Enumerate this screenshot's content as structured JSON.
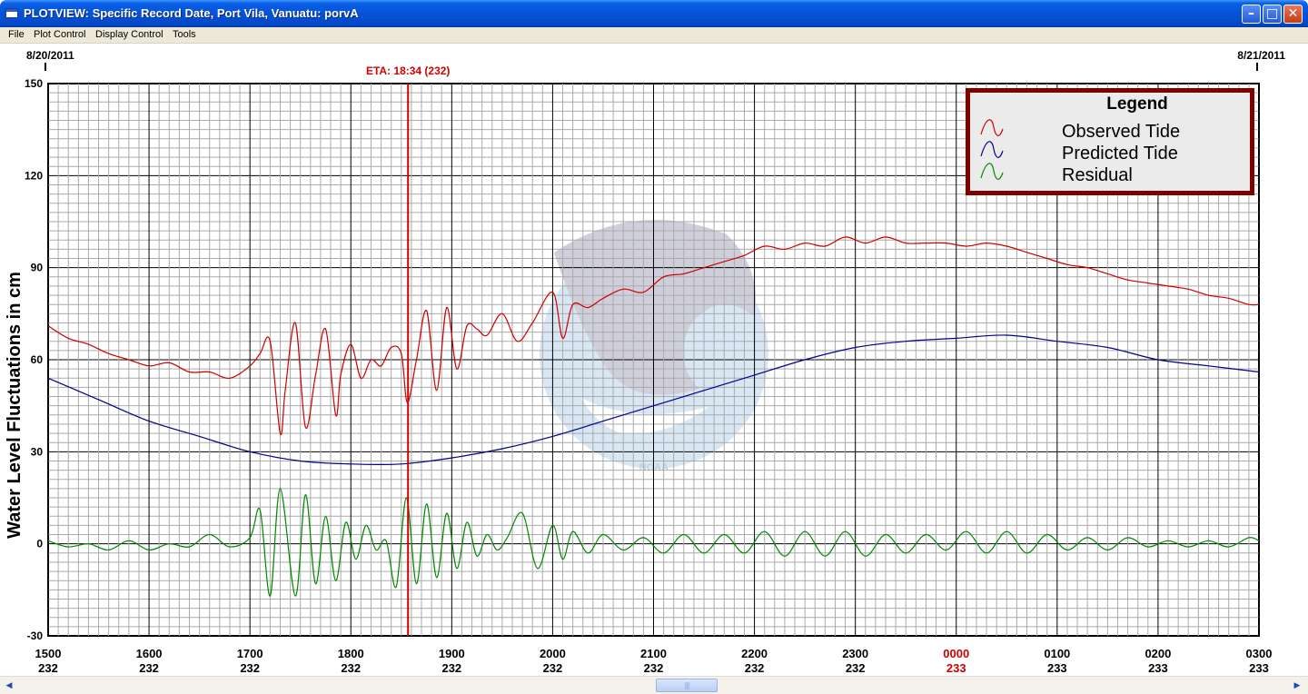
{
  "window": {
    "title": "PLOTVIEW: Specific Record Date, Port Vila, Vanuatu: porvA",
    "minimize_glyph": "–",
    "maximize_glyph": "□",
    "close_glyph": "✕"
  },
  "menu": [
    "File",
    "Plot Control",
    "Display Control",
    "Tools"
  ],
  "plot": {
    "date_left": "8/20/2011",
    "date_right": "8/21/2011",
    "eta_label": "ETA: 18:34 (232)",
    "eta_time_hours": 18.5667,
    "watermark": "NOAA",
    "colors": {
      "observed": "#cc0000",
      "predicted": "#00008b",
      "residual": "#008800",
      "eta": "#d40000",
      "legend_border": "#800000"
    }
  },
  "legend": {
    "title": "Legend",
    "items": [
      {
        "label": "Observed Tide",
        "color": "#cc0000"
      },
      {
        "label": "Predicted Tide",
        "color": "#00008b"
      },
      {
        "label": "Residual",
        "color": "#008800"
      }
    ]
  },
  "chart_data": {
    "type": "line",
    "ylabel": "Water Level Fluctuations in cm",
    "ylim": [
      -30,
      150
    ],
    "yticks": [
      150,
      120,
      90,
      60,
      30,
      0,
      -30
    ],
    "xlim": [
      15,
      27
    ],
    "xticks": [
      {
        "time": "1500",
        "day": "232",
        "highlight": false
      },
      {
        "time": "1600",
        "day": "232",
        "highlight": false
      },
      {
        "time": "1700",
        "day": "232",
        "highlight": false
      },
      {
        "time": "1800",
        "day": "232",
        "highlight": false
      },
      {
        "time": "1900",
        "day": "232",
        "highlight": false
      },
      {
        "time": "2000",
        "day": "232",
        "highlight": false
      },
      {
        "time": "2100",
        "day": "232",
        "highlight": false
      },
      {
        "time": "2200",
        "day": "232",
        "highlight": false
      },
      {
        "time": "2300",
        "day": "232",
        "highlight": false
      },
      {
        "time": "0000",
        "day": "233",
        "highlight": true
      },
      {
        "time": "0100",
        "day": "233",
        "highlight": false
      },
      {
        "time": "0200",
        "day": "233",
        "highlight": false
      },
      {
        "time": "0300",
        "day": "233",
        "highlight": false
      }
    ],
    "grid": true,
    "legend_position": "top-right",
    "series": [
      {
        "name": "Observed Tide",
        "color": "#cc0000",
        "x": [
          15.0,
          15.2,
          15.4,
          15.6,
          15.8,
          16.0,
          16.2,
          16.4,
          16.6,
          16.8,
          17.0,
          17.1,
          17.2,
          17.3,
          17.35,
          17.45,
          17.55,
          17.65,
          17.75,
          17.85,
          17.9,
          18.0,
          18.1,
          18.2,
          18.3,
          18.4,
          18.5,
          18.56,
          18.65,
          18.75,
          18.85,
          18.95,
          19.05,
          19.15,
          19.25,
          19.35,
          19.5,
          19.65,
          19.8,
          20.0,
          20.1,
          20.2,
          20.35,
          20.5,
          20.7,
          20.9,
          21.1,
          21.3,
          21.5,
          21.7,
          21.9,
          22.1,
          22.3,
          22.5,
          22.7,
          22.9,
          23.1,
          23.3,
          23.5,
          23.7,
          23.9,
          24.1,
          24.3,
          24.5,
          24.7,
          24.9,
          25.1,
          25.3,
          25.5,
          25.7,
          25.9,
          26.1,
          26.3,
          26.5,
          26.7,
          26.9,
          27.0
        ],
        "values": [
          71,
          67,
          65,
          62,
          60,
          58,
          59,
          56,
          56,
          54,
          58,
          62,
          66,
          36,
          50,
          72,
          38,
          55,
          70,
          42,
          55,
          65,
          54,
          60,
          58,
          64,
          62,
          46,
          60,
          76,
          50,
          77,
          57,
          71,
          70,
          68,
          75,
          66,
          72,
          82,
          67,
          78,
          77,
          80,
          83,
          82,
          87,
          88,
          90,
          92,
          94,
          97,
          96,
          98,
          97,
          100,
          98,
          100,
          98,
          98,
          98,
          97,
          98,
          97,
          95,
          93,
          91,
          90,
          88,
          86,
          85,
          84,
          83,
          81,
          80,
          78,
          78
        ]
      },
      {
        "name": "Predicted Tide",
        "color": "#00008b",
        "x": [
          15.0,
          15.5,
          16.0,
          16.5,
          17.0,
          17.5,
          18.0,
          18.5,
          19.0,
          19.5,
          20.0,
          20.5,
          21.0,
          21.5,
          22.0,
          22.5,
          23.0,
          23.5,
          24.0,
          24.5,
          25.0,
          25.5,
          26.0,
          26.5,
          27.0
        ],
        "values": [
          54,
          47,
          40,
          35,
          30,
          27,
          26,
          26,
          28,
          31,
          35,
          40,
          45,
          50,
          55,
          60,
          64,
          66,
          67,
          68,
          66,
          64,
          60,
          58,
          56
        ]
      },
      {
        "name": "Residual",
        "color": "#008800",
        "x": [
          15.0,
          15.2,
          15.4,
          15.6,
          15.8,
          16.0,
          16.2,
          16.4,
          16.6,
          16.8,
          17.0,
          17.1,
          17.2,
          17.3,
          17.45,
          17.55,
          17.65,
          17.75,
          17.85,
          17.95,
          18.05,
          18.15,
          18.25,
          18.35,
          18.45,
          18.55,
          18.65,
          18.75,
          18.85,
          18.95,
          19.05,
          19.15,
          19.25,
          19.35,
          19.45,
          19.55,
          19.7,
          19.85,
          20.0,
          20.1,
          20.2,
          20.35,
          20.5,
          20.7,
          20.9,
          21.1,
          21.3,
          21.5,
          21.7,
          21.9,
          22.1,
          22.3,
          22.5,
          22.7,
          22.9,
          23.1,
          23.3,
          23.5,
          23.7,
          23.9,
          24.1,
          24.3,
          24.5,
          24.7,
          24.9,
          25.1,
          25.3,
          25.5,
          25.7,
          25.9,
          26.1,
          26.3,
          26.5,
          26.7,
          26.9,
          27.0
        ],
        "values": [
          1,
          -1,
          0,
          -2,
          1,
          -2,
          0,
          -1,
          3,
          -1,
          2,
          11,
          -17,
          18,
          -17,
          16,
          -13,
          9,
          -12,
          7,
          -5,
          6,
          -2,
          1,
          -14,
          15,
          -13,
          13,
          -11,
          10,
          -8,
          7,
          -4,
          3,
          -2,
          2,
          10,
          -8,
          6,
          -5,
          4,
          -3,
          3,
          -2,
          2,
          -3,
          3,
          -3,
          3,
          -3,
          4,
          -4,
          4,
          -4,
          4,
          -4,
          3,
          -3,
          3,
          -2,
          4,
          -3,
          4,
          -3,
          3,
          -2,
          2,
          -2,
          2,
          -1,
          1,
          -1,
          1,
          -1,
          2,
          1
        ]
      }
    ]
  }
}
